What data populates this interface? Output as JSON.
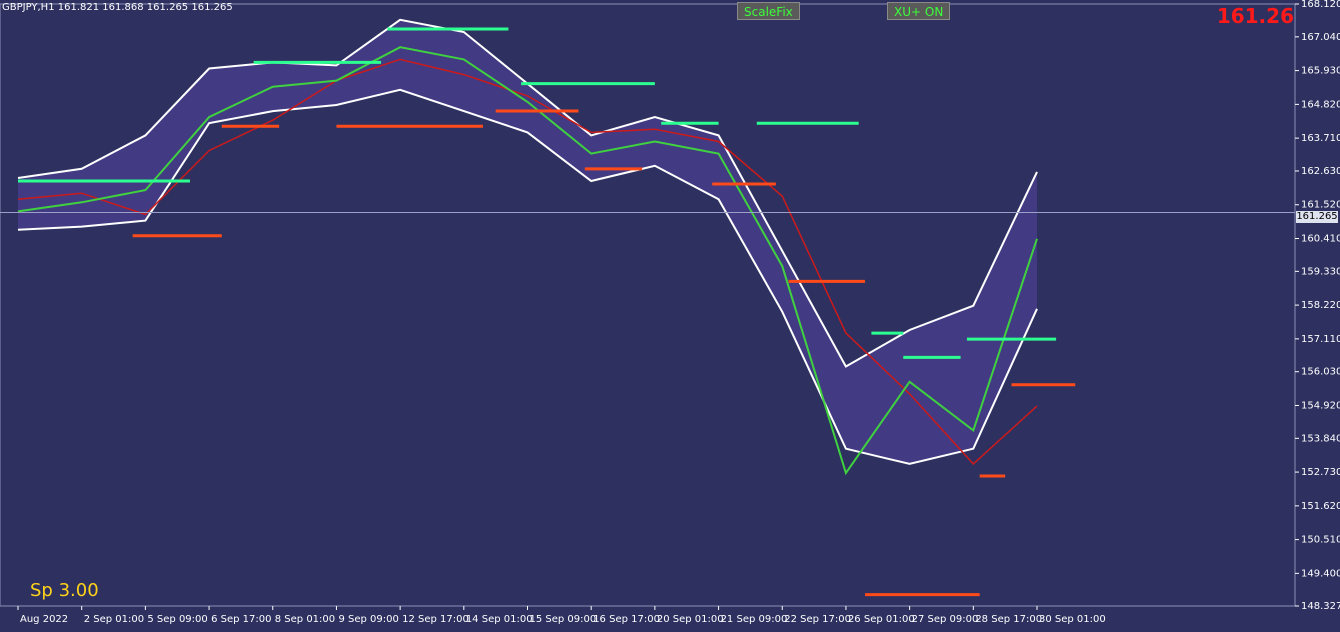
{
  "header": {
    "symbol_line": "GBPJPY,H1  161.821 161.868 161.265 161.265",
    "big_price": "161.26"
  },
  "buttons": {
    "scalefix": "ScaleFix",
    "xu": "XU+ ON"
  },
  "spread_label": "Sp 3.00",
  "current_price_tag": "161.265",
  "colors": {
    "background": "#2e3160",
    "band_outline": "#ffffff",
    "support": "#ff4a1a",
    "resistance": "#2bff8f",
    "ma_fast": "#3fd13f",
    "ma_slow": "#cc1a1a",
    "accent_price": "#ff1a1a",
    "spread": "#ffd21a"
  },
  "chart_data": {
    "type": "line",
    "title": "GBPJPY,H1",
    "ylim": [
      148.327,
      168.12
    ],
    "y_ticks": [
      "168.120",
      "167.040",
      "165.930",
      "164.820",
      "163.710",
      "162.630",
      "161.520",
      "160.410",
      "159.330",
      "158.220",
      "157.110",
      "156.030",
      "154.920",
      "153.840",
      "152.730",
      "151.620",
      "150.510",
      "149.400",
      "148.327"
    ],
    "x_ticks": [
      "Aug 2022",
      "2 Sep 01:00",
      "5 Sep 09:00",
      "6 Sep 17:00",
      "8 Sep 01:00",
      "9 Sep 09:00",
      "12 Sep 17:00",
      "14 Sep 01:00",
      "15 Sep 09:00",
      "16 Sep 17:00",
      "20 Sep 01:00",
      "21 Sep 09:00",
      "22 Sep 17:00",
      "26 Sep 01:00",
      "27 Sep 09:00",
      "28 Sep 17:00",
      "30 Sep 01:00"
    ],
    "current_price": 161.265,
    "band_upper": [
      [
        0,
        162.4
      ],
      [
        1,
        162.7
      ],
      [
        2,
        163.8
      ],
      [
        3,
        166.0
      ],
      [
        4,
        166.2
      ],
      [
        5,
        166.1
      ],
      [
        6,
        167.6
      ],
      [
        7,
        167.2
      ],
      [
        8,
        165.5
      ],
      [
        9,
        163.8
      ],
      [
        10,
        164.4
      ],
      [
        11,
        163.8
      ],
      [
        12,
        160.0
      ],
      [
        13,
        156.2
      ],
      [
        14,
        157.4
      ],
      [
        15,
        158.2
      ],
      [
        16,
        162.6
      ]
    ],
    "band_lower": [
      [
        0,
        160.7
      ],
      [
        1,
        160.8
      ],
      [
        2,
        161.0
      ],
      [
        3,
        164.2
      ],
      [
        4,
        164.6
      ],
      [
        5,
        164.8
      ],
      [
        6,
        165.3
      ],
      [
        7,
        164.6
      ],
      [
        8,
        163.9
      ],
      [
        9,
        162.3
      ],
      [
        10,
        162.8
      ],
      [
        11,
        161.7
      ],
      [
        12,
        158.0
      ],
      [
        13,
        153.5
      ],
      [
        14,
        153.0
      ],
      [
        15,
        153.5
      ],
      [
        16,
        158.1
      ]
    ],
    "ma_fast": [
      [
        0,
        161.3
      ],
      [
        1,
        161.6
      ],
      [
        2,
        162.0
      ],
      [
        3,
        164.4
      ],
      [
        4,
        165.4
      ],
      [
        5,
        165.6
      ],
      [
        6,
        166.7
      ],
      [
        7,
        166.3
      ],
      [
        8,
        164.9
      ],
      [
        9,
        163.2
      ],
      [
        10,
        163.6
      ],
      [
        11,
        163.2
      ],
      [
        12,
        159.5
      ],
      [
        13,
        152.7
      ],
      [
        14,
        155.7
      ],
      [
        15,
        154.1
      ],
      [
        16,
        160.4
      ]
    ],
    "ma_slow": [
      [
        0,
        161.7
      ],
      [
        1,
        161.9
      ],
      [
        2,
        161.2
      ],
      [
        3,
        163.3
      ],
      [
        4,
        164.3
      ],
      [
        5,
        165.6
      ],
      [
        6,
        166.3
      ],
      [
        7,
        165.8
      ],
      [
        8,
        165.1
      ],
      [
        9,
        163.9
      ],
      [
        10,
        164.0
      ],
      [
        11,
        163.6
      ],
      [
        12,
        161.8
      ],
      [
        13,
        157.3
      ],
      [
        14,
        155.3
      ],
      [
        15,
        153.0
      ],
      [
        16,
        154.9
      ]
    ],
    "resistance_levels": [
      {
        "x0": 0,
        "x1": 2.7,
        "y": 162.3
      },
      {
        "x0": 3.7,
        "x1": 5.7,
        "y": 166.2
      },
      {
        "x0": 5.8,
        "x1": 7.7,
        "y": 167.3
      },
      {
        "x0": 7.9,
        "x1": 10.0,
        "y": 165.5
      },
      {
        "x0": 10.1,
        "x1": 11.0,
        "y": 164.2
      },
      {
        "x0": 11.6,
        "x1": 13.2,
        "y": 164.2
      },
      {
        "x0": 13.4,
        "x1": 13.9,
        "y": 157.3
      },
      {
        "x0": 13.9,
        "x1": 14.8,
        "y": 156.5
      },
      {
        "x0": 14.9,
        "x1": 16.3,
        "y": 157.1
      }
    ],
    "support_levels": [
      {
        "x0": 1.8,
        "x1": 3.2,
        "y": 160.5
      },
      {
        "x0": 3.2,
        "x1": 4.1,
        "y": 164.1
      },
      {
        "x0": 5.0,
        "x1": 7.3,
        "y": 164.1
      },
      {
        "x0": 7.5,
        "x1": 8.8,
        "y": 164.6
      },
      {
        "x0": 8.9,
        "x1": 9.8,
        "y": 162.7
      },
      {
        "x0": 10.9,
        "x1": 11.9,
        "y": 162.2
      },
      {
        "x0": 12.1,
        "x1": 13.3,
        "y": 159.0
      },
      {
        "x0": 13.3,
        "x1": 15.1,
        "y": 148.7
      },
      {
        "x0": 15.1,
        "x1": 15.5,
        "y": 152.6
      },
      {
        "x0": 15.6,
        "x1": 16.6,
        "y": 155.6
      }
    ]
  }
}
